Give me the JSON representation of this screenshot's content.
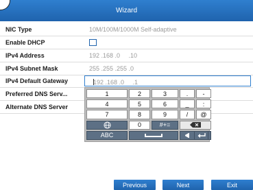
{
  "window": {
    "title": "Wizard"
  },
  "form": {
    "rows": [
      {
        "label": "NIC Type",
        "value": "10M/100M/1000M Self-adaptive"
      },
      {
        "label": "Enable DHCP",
        "checked": false
      },
      {
        "label": "IPv4 Address",
        "value": "192 .168 .0     .10"
      },
      {
        "label": "IPv4 Subnet Mask",
        "value": "255 .255 .255 .0"
      },
      {
        "label": "IPv4 Default Gateway",
        "value": "192 .168 .0     .1"
      },
      {
        "label": "Preferred DNS Serv...",
        "value": ""
      },
      {
        "label": "Alternate DNS Server",
        "value": ""
      }
    ]
  },
  "keyboard": {
    "keys": {
      "k1": "1",
      "k2": "2",
      "k3": "3",
      "dot": ".",
      "dash": "-",
      "k4": "4",
      "k5": "5",
      "k6": "6",
      "underscore": "_",
      "colon": ":",
      "k7": "7",
      "k8": "8",
      "k9": "9",
      "slash": "/",
      "at": "@",
      "k0": "0",
      "symbols": "#+=",
      "abc": "ABC"
    },
    "icons": [
      "globe-icon",
      "backspace-icon",
      "space-icon",
      "arrow-left-icon",
      "arrow-right-icon",
      "enter-icon"
    ]
  },
  "footer": {
    "previous": "Previous",
    "next": "Next",
    "exit": "Exit"
  },
  "colors": {
    "accent": "#1f63ad",
    "keyboard_dark": "#5d7085"
  }
}
